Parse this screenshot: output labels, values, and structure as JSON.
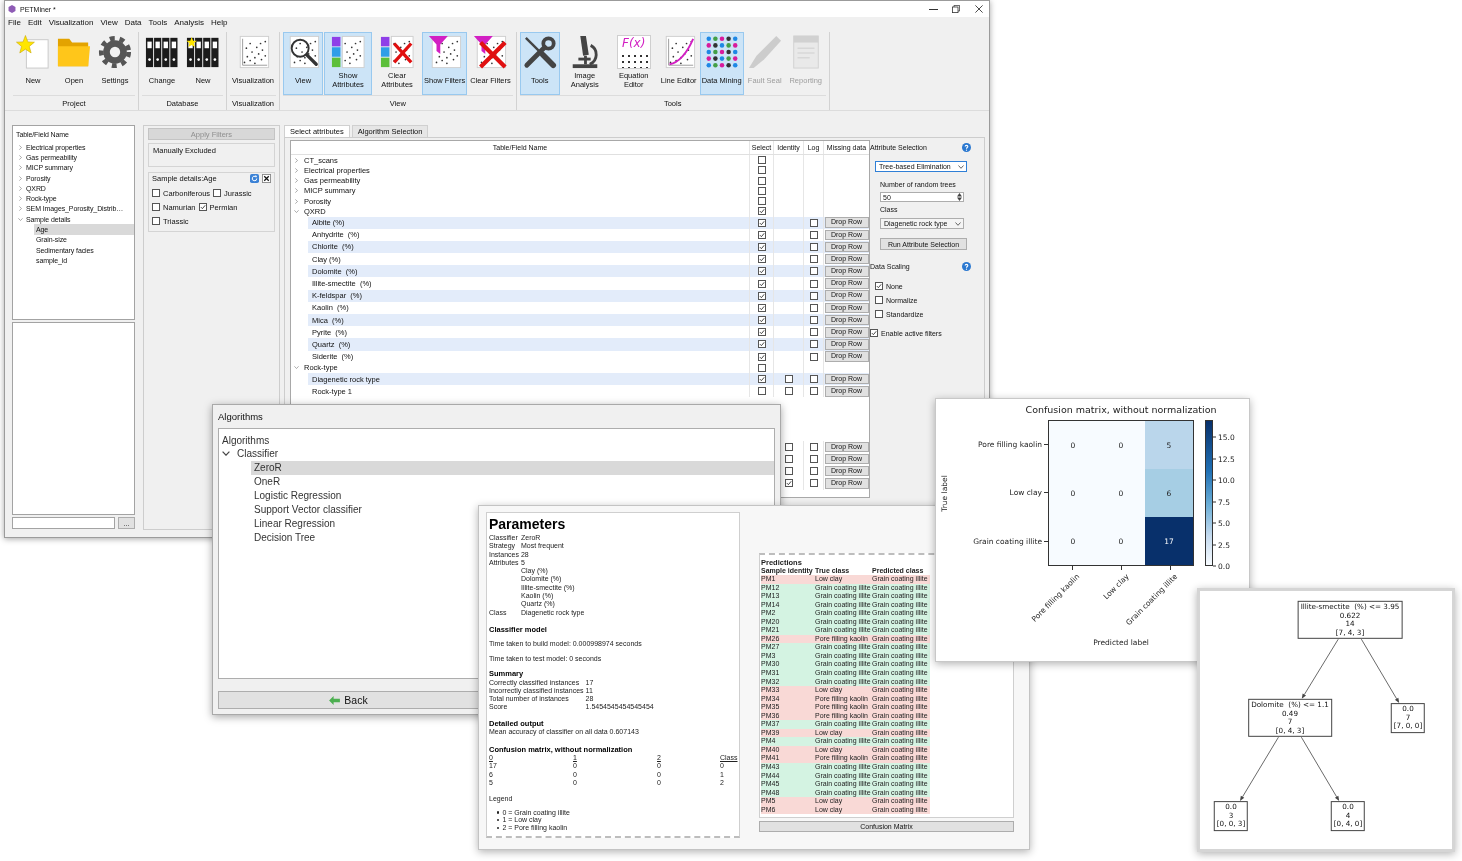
{
  "main_window": {
    "title": "PETMiner *",
    "menu": [
      "File",
      "Edit",
      "Visualization",
      "View",
      "Data",
      "Tools",
      "Analysis",
      "Help"
    ],
    "ribbon": [
      {
        "label": "Project",
        "buttons": [
          {
            "label": "New",
            "kind": "star",
            "on": false,
            "disabled": false
          },
          {
            "label": "Open",
            "kind": "folder",
            "on": false,
            "disabled": false
          },
          {
            "label": "Settings",
            "kind": "gear",
            "on": false,
            "disabled": false
          }
        ]
      },
      {
        "label": "Database",
        "buttons": [
          {
            "label": "Change",
            "kind": "binders",
            "on": false,
            "disabled": false
          },
          {
            "label": "New",
            "kind": "binders-star",
            "on": false,
            "disabled": false
          }
        ]
      },
      {
        "label": "Visualization",
        "buttons": [
          {
            "label": "Visualization",
            "kind": "scatter",
            "on": false,
            "disabled": false
          }
        ]
      },
      {
        "label": "View",
        "buttons": [
          {
            "label": "View",
            "kind": "magnifier",
            "on": true,
            "disabled": false
          },
          {
            "label": "Show Attributes",
            "kind": "attributes",
            "on": true,
            "disabled": false
          },
          {
            "label": "Clear Attributes",
            "kind": "clear-attributes",
            "on": false,
            "disabled": false
          },
          {
            "label": "Show Filters",
            "kind": "filter",
            "on": true,
            "disabled": false
          },
          {
            "label": "Clear Filters",
            "kind": "clear-filter",
            "on": false,
            "disabled": false
          }
        ]
      },
      {
        "label": "Tools",
        "buttons": [
          {
            "label": "Tools",
            "kind": "tools",
            "on": true,
            "disabled": false
          },
          {
            "label": "Image Analysis",
            "kind": "microscope",
            "on": false,
            "disabled": false
          },
          {
            "label": "Equation Editor",
            "kind": "equation",
            "glyph": "F(x)",
            "on": false,
            "disabled": false
          },
          {
            "label": "Line Editor",
            "kind": "line-plot",
            "on": false,
            "disabled": false
          },
          {
            "label": "Data Mining",
            "kind": "dot-grid",
            "on": true,
            "disabled": false
          },
          {
            "label": "Fault Seal",
            "kind": "pencil",
            "on": false,
            "disabled": true
          },
          {
            "label": "Reporting",
            "kind": "report",
            "on": false,
            "disabled": true
          }
        ]
      }
    ],
    "field_tree": {
      "header": "Table/Field Name",
      "items": [
        {
          "label": "Electrical properties",
          "expanded": false,
          "selected": false
        },
        {
          "label": "Gas permeability",
          "expanded": false,
          "selected": false
        },
        {
          "label": "MICP summary",
          "expanded": false,
          "selected": false
        },
        {
          "label": "Porosity",
          "expanded": false,
          "selected": false
        },
        {
          "label": "QXRD",
          "expanded": false,
          "selected": false
        },
        {
          "label": "Rock-type",
          "expanded": false,
          "selected": false
        },
        {
          "label": "SEM Images_Porosity_Distrib…",
          "expanded": false,
          "selected": false
        },
        {
          "label": "Sample details",
          "expanded": true,
          "selected": false,
          "children": [
            {
              "label": "Age",
              "selected": true
            },
            {
              "label": "Grain-size",
              "selected": false
            },
            {
              "label": "Sedimentary facies",
              "selected": false
            },
            {
              "label": "sample_id",
              "selected": false
            }
          ]
        }
      ]
    },
    "browse_button": "...",
    "filters": {
      "apply_button": {
        "label": "Apply Filters",
        "disabled": true
      },
      "excluded_group": "Manually Excluded",
      "age_filter": {
        "title": "Sample details:Age",
        "options": [
          {
            "label": "Carboniferous",
            "checked": false
          },
          {
            "label": "Jurassic",
            "checked": false
          },
          {
            "label": "Namurian",
            "checked": false
          },
          {
            "label": "Permian",
            "checked": true
          },
          {
            "label": "Triassic",
            "checked": false
          }
        ]
      }
    },
    "tabs": [
      {
        "label": "Select attributes",
        "selected": true
      },
      {
        "label": "Algorithm Selection",
        "selected": false
      }
    ],
    "attribute_table": {
      "columns": [
        "Table/Field Name",
        "Select",
        "Identity",
        "Log",
        "Missing data"
      ],
      "rows": [
        {
          "name": "CT_scans",
          "expanded": false,
          "select": false
        },
        {
          "name": "Electrical properties",
          "expanded": false,
          "select": false
        },
        {
          "name": "Gas permeability",
          "expanded": false,
          "select": false
        },
        {
          "name": "MICP summary",
          "expanded": false,
          "select": false
        },
        {
          "name": "Porosity",
          "expanded": false,
          "select": false
        },
        {
          "name": "QXRD",
          "expanded": true,
          "select": true,
          "children": [
            {
              "name": "Albite (%)",
              "shaded": true,
              "select": true,
              "log": false,
              "missing_data": "Drop Row"
            },
            {
              "name": "Anhydrite  (%)",
              "shaded": false,
              "select": true,
              "log": false,
              "missing_data": "Drop Row"
            },
            {
              "name": "Chlorite  (%)",
              "shaded": true,
              "select": true,
              "log": false,
              "missing_data": "Drop Row"
            },
            {
              "name": "Clay (%)",
              "shaded": false,
              "select": true,
              "log": false,
              "missing_data": "Drop Row"
            },
            {
              "name": "Dolomite  (%)",
              "shaded": true,
              "select": true,
              "log": false,
              "missing_data": "Drop Row"
            },
            {
              "name": "Illite-smectite  (%)",
              "shaded": false,
              "select": true,
              "log": false,
              "missing_data": "Drop Row"
            },
            {
              "name": "K-feldspar  (%)",
              "shaded": true,
              "select": true,
              "log": false,
              "missing_data": "Drop Row"
            },
            {
              "name": "Kaolin  (%)",
              "shaded": false,
              "select": true,
              "log": false,
              "missing_data": "Drop Row"
            },
            {
              "name": "Mica  (%)",
              "shaded": true,
              "select": true,
              "log": false,
              "missing_data": "Drop Row"
            },
            {
              "name": "Pyrite  (%)",
              "shaded": false,
              "select": true,
              "log": false,
              "missing_data": "Drop Row"
            },
            {
              "name": "Quartz  (%)",
              "shaded": true,
              "select": true,
              "log": false,
              "missing_data": "Drop Row"
            },
            {
              "name": "Siderite  (%)",
              "shaded": false,
              "select": true,
              "log": false,
              "missing_data": "Drop Row"
            }
          ]
        },
        {
          "name": "Rock-type",
          "expanded": true,
          "select": false,
          "children": [
            {
              "name": "Diagenetic rock type",
              "shaded": true,
              "select": true,
              "identity": false,
              "log": false,
              "missing_data": "Drop Row"
            },
            {
              "name": "Rock-type 1",
              "shaded": false,
              "select": false,
              "identity": false,
              "log": false,
              "missing_data": "Drop Row"
            }
          ]
        }
      ],
      "rows_below_overlap": [
        {
          "identity": false,
          "log": false,
          "missing_data": "Drop Row"
        },
        {
          "identity": false,
          "log": false,
          "missing_data": "Drop Row"
        },
        {
          "identity": false,
          "log": false,
          "missing_data": "Drop Row"
        },
        {
          "identity": true,
          "log": false,
          "missing_data": "Drop Row"
        }
      ]
    },
    "attribute_selection": {
      "title": "Attribute Selection",
      "method": {
        "value": "Tree-based Elimination",
        "focused": true
      },
      "trees_label": "Number of random trees",
      "trees_value": "50",
      "class_label": "Class",
      "class_value": "Diagenetic rock type",
      "run_button": "Run Attribute Selection"
    },
    "data_scaling": {
      "title": "Data Scaling",
      "options": [
        {
          "label": "None",
          "checked": true
        },
        {
          "label": "Normalize",
          "checked": false
        },
        {
          "label": "Standardize",
          "checked": false
        }
      ]
    },
    "active_filters": {
      "label": "Enable active filters",
      "checked": true
    }
  },
  "algorithms_window": {
    "title": "Algorithms",
    "tree": {
      "header": "Algorithms",
      "items": [
        {
          "label": "Classifier",
          "expanded": true,
          "selected": false,
          "children": [
            {
              "label": "ZeroR",
              "selected": true
            },
            {
              "label": "OneR",
              "selected": false
            },
            {
              "label": "Logistic Regression",
              "selected": false
            },
            {
              "label": "Support Vector classifier",
              "selected": false
            },
            {
              "label": "Linear Regression",
              "selected": false
            },
            {
              "label": "Decision Tree",
              "selected": false
            }
          ]
        }
      ]
    },
    "back_button": "Back"
  },
  "results_window": {
    "report": {
      "heading": "Parameters",
      "info": [
        {
          "label": "Classifier",
          "value": "ZeroR"
        },
        {
          "label": "Strategy",
          "value": "Most frequent"
        },
        {
          "label": "Instances",
          "value": "28"
        },
        {
          "label": "Attributes",
          "value": "5",
          "items": [
            "Clay (%)",
            "Dolomite (%)",
            "Illite-smectite (%)",
            "Kaolin (%)",
            "Quartz (%)"
          ]
        },
        {
          "label": "Class",
          "value": "Diagenetic rock type"
        }
      ],
      "classifier_model": {
        "heading": "Classifier model",
        "lines": [
          "Time taken to build model: 0.000998974 seconds",
          "Time taken to test model: 0 seconds"
        ]
      },
      "summary": {
        "heading": "Summary",
        "rows": [
          {
            "label": "Correctly classified instances",
            "value": "17"
          },
          {
            "label": "Incorrectly classified instances",
            "value": "11"
          },
          {
            "label": "Total number of instances",
            "value": "28"
          },
          {
            "label": "Score",
            "value": "1.5454545454545454"
          }
        ]
      },
      "detailed_output": {
        "heading": "Detailed output",
        "text": "Mean accuracy of classifier on all data 0.607143"
      },
      "confusion_matrix": {
        "heading": "Confusion matrix, without normalization",
        "columns": [
          "0",
          "1",
          "2",
          "Class"
        ],
        "rows": [
          [
            "17",
            "0",
            "0",
            "0"
          ],
          [
            "6",
            "0",
            "0",
            "1"
          ],
          [
            "5",
            "0",
            "0",
            "2"
          ]
        ]
      },
      "legend": {
        "heading": "Legend",
        "items": [
          "0 = Grain coating illite",
          "1 = Low clay",
          "2 = Pore filling kaolin"
        ]
      }
    },
    "predictions": {
      "heading": "Predictions",
      "columns": [
        "Sample identity",
        "True class",
        "Predicted class"
      ],
      "rows": [
        {
          "sample": "PM1",
          "true_class": "Low clay",
          "predicted_class": "Grain coating illite",
          "correct": false
        },
        {
          "sample": "PM12",
          "true_class": "Grain coating illite",
          "predicted_class": "Grain coating illite",
          "correct": true
        },
        {
          "sample": "PM13",
          "true_class": "Grain coating illite",
          "predicted_class": "Grain coating illite",
          "correct": true
        },
        {
          "sample": "PM14",
          "true_class": "Grain coating illite",
          "predicted_class": "Grain coating illite",
          "correct": true
        },
        {
          "sample": "PM2",
          "true_class": "Grain coating illite",
          "predicted_class": "Grain coating illite",
          "correct": true
        },
        {
          "sample": "PM20",
          "true_class": "Grain coating illite",
          "predicted_class": "Grain coating illite",
          "correct": true
        },
        {
          "sample": "PM21",
          "true_class": "Grain coating illite",
          "predicted_class": "Grain coating illite",
          "correct": true
        },
        {
          "sample": "PM26",
          "true_class": "Pore filling kaolin",
          "predicted_class": "Grain coating illite",
          "correct": false
        },
        {
          "sample": "PM27",
          "true_class": "Grain coating illite",
          "predicted_class": "Grain coating illite",
          "correct": true
        },
        {
          "sample": "PM3",
          "true_class": "Grain coating illite",
          "predicted_class": "Grain coating illite",
          "correct": true
        },
        {
          "sample": "PM30",
          "true_class": "Grain coating illite",
          "predicted_class": "Grain coating illite",
          "correct": true
        },
        {
          "sample": "PM31",
          "true_class": "Grain coating illite",
          "predicted_class": "Grain coating illite",
          "correct": true
        },
        {
          "sample": "PM32",
          "true_class": "Grain coating illite",
          "predicted_class": "Grain coating illite",
          "correct": true
        },
        {
          "sample": "PM33",
          "true_class": "Low clay",
          "predicted_class": "Grain coating illite",
          "correct": false
        },
        {
          "sample": "PM34",
          "true_class": "Pore filling kaolin",
          "predicted_class": "Grain coating illite",
          "correct": false
        },
        {
          "sample": "PM35",
          "true_class": "Pore filling kaolin",
          "predicted_class": "Grain coating illite",
          "correct": false
        },
        {
          "sample": "PM36",
          "true_class": "Pore filling kaolin",
          "predicted_class": "Grain coating illite",
          "correct": false
        },
        {
          "sample": "PM37",
          "true_class": "Grain coating illite",
          "predicted_class": "Grain coating illite",
          "correct": true
        },
        {
          "sample": "PM39",
          "true_class": "Low clay",
          "predicted_class": "Grain coating illite",
          "correct": false
        },
        {
          "sample": "PM4",
          "true_class": "Grain coating illite",
          "predicted_class": "Grain coating illite",
          "correct": true
        },
        {
          "sample": "PM40",
          "true_class": "Low clay",
          "predicted_class": "Grain coating illite",
          "correct": false
        },
        {
          "sample": "PM41",
          "true_class": "Pore filling kaolin",
          "predicted_class": "Grain coating illite",
          "correct": false
        },
        {
          "sample": "PM43",
          "true_class": "Grain coating illite",
          "predicted_class": "Grain coating illite",
          "correct": true
        },
        {
          "sample": "PM44",
          "true_class": "Grain coating illite",
          "predicted_class": "Grain coating illite",
          "correct": true
        },
        {
          "sample": "PM45",
          "true_class": "Grain coating illite",
          "predicted_class": "Grain coating illite",
          "correct": true
        },
        {
          "sample": "PM48",
          "true_class": "Grain coating illite",
          "predicted_class": "Grain coating illite",
          "correct": true
        },
        {
          "sample": "PM5",
          "true_class": "Low clay",
          "predicted_class": "Grain coating illite",
          "correct": false
        },
        {
          "sample": "PM6",
          "true_class": "Low clay",
          "predicted_class": "Grain coating illite",
          "correct": false
        }
      ]
    },
    "confusion_button": "Confusion Matrix"
  },
  "confusion_plot_window": {
    "title": "Confusion matrix, without normalization",
    "ylabel": "True label",
    "xlabel": "Predicted label",
    "row_labels": [
      "Pore filling kaolin",
      "Low clay",
      "Grain coating illite"
    ],
    "column_labels": [
      "Pore filling kaolin",
      "Low clay",
      "Grain coating illite"
    ],
    "cells": [
      [
        {
          "value": "0",
          "color": "#f7fbff"
        },
        {
          "value": "0",
          "color": "#f7fbff"
        },
        {
          "value": "5",
          "color": "#bad6eb"
        }
      ],
      [
        {
          "value": "0",
          "color": "#f7fbff"
        },
        {
          "value": "0",
          "color": "#f7fbff"
        },
        {
          "value": "6",
          "color": "#a6cee4"
        }
      ],
      [
        {
          "value": "0",
          "color": "#f7fbff"
        },
        {
          "value": "0",
          "color": "#f7fbff"
        },
        {
          "value": "17",
          "color": "#08306b"
        }
      ]
    ],
    "colorbar_ticks": [
      "15.0",
      "12.5",
      "10.0",
      "7.5",
      "5.0",
      "2.5",
      "0.0"
    ]
  },
  "decision_tree_window": {
    "root": {
      "lines": [
        "Illite-smectite  (%) <= 3.95",
        "0.622",
        "14",
        "[7, 4, 3]"
      ],
      "children": [
        {
          "lines": [
            "Dolomite  (%) <= 1.1",
            "0.49",
            "7",
            "[0, 4, 3]"
          ],
          "children": [
            {
              "lines": [
                "0.0",
                "3",
                "[0, 0, 3]"
              ]
            },
            {
              "lines": [
                "0.0",
                "4",
                "[0, 4, 0]"
              ]
            }
          ]
        },
        {
          "lines": [
            "0.0",
            "7",
            "[7, 0, 0]"
          ]
        }
      ]
    }
  }
}
